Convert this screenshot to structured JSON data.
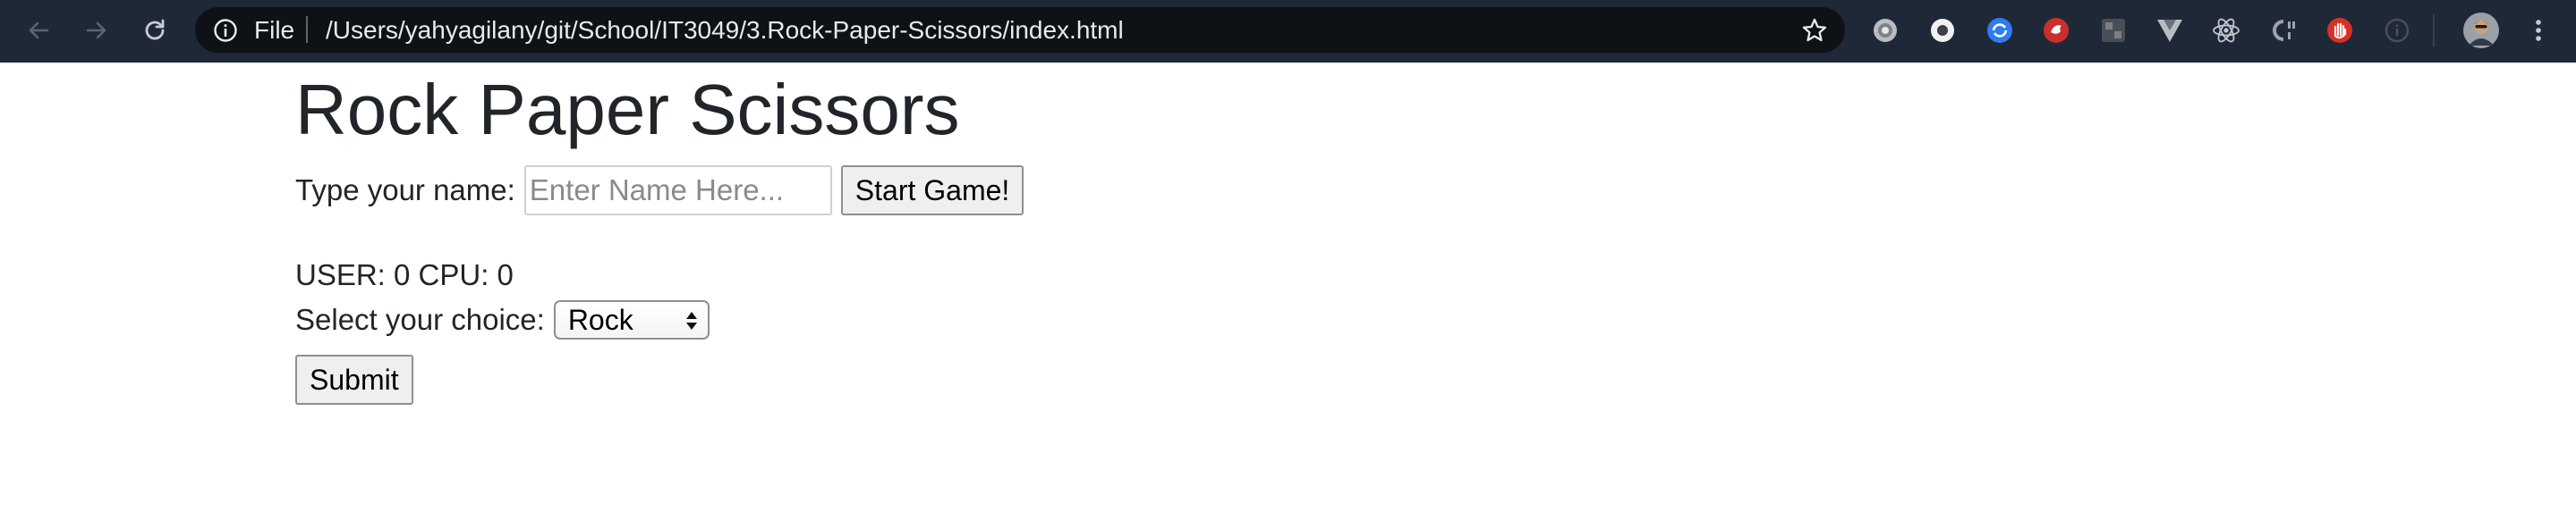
{
  "browser": {
    "scheme_label": "File",
    "url": "/Users/yahyagilany/git/School/IT3049/3.Rock-Paper-Scissors/index.html",
    "icons": [
      "back-arrow-icon",
      "forward-arrow-icon",
      "reload-icon",
      "info-icon",
      "star-icon",
      "menu-dots-icon"
    ],
    "extensions": [
      "gray-circle-extension-icon",
      "white-ring-extension-icon",
      "blue-circle-extension-icon",
      "red-bird-extension-icon",
      "grid-extension-icon",
      "vue-extension-icon",
      "react-extension-icon",
      "c-brackets-extension-icon",
      "red-hand-extension-icon",
      "info-circle-extension-icon"
    ],
    "colors": {
      "toolbar": "#1f2837",
      "omnibox": "#0e1116",
      "text": "#e8eaed"
    }
  },
  "page": {
    "title": "Rock Paper Scissors",
    "name_label": "Type your name:",
    "name_placeholder": "Enter Name Here...",
    "name_value": "",
    "start_button": "Start Game!",
    "score": {
      "text": "USER: 0 CPU: 0",
      "user": 0,
      "cpu": 0
    },
    "choice_label": "Select your choice:",
    "choice_selected": "Rock",
    "submit_button": "Submit"
  }
}
